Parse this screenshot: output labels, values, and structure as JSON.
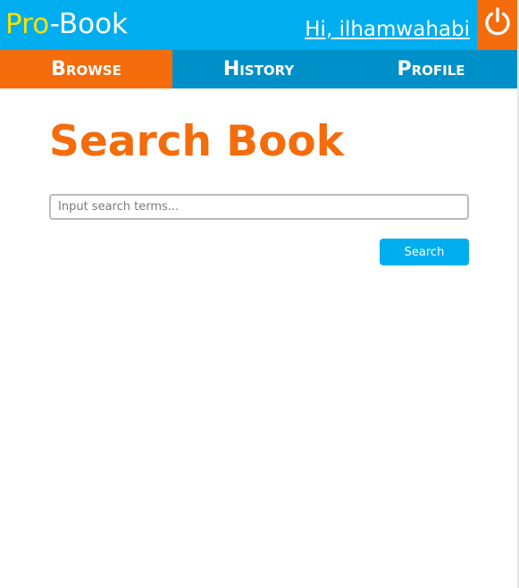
{
  "header": {
    "logo_prefix": "Pro",
    "logo_suffix": "-Book",
    "greeting": "Hi, ilhamwahabi",
    "logout_icon": "power-icon"
  },
  "nav": {
    "items": [
      {
        "label": "Browse",
        "active": true
      },
      {
        "label": "History",
        "active": false
      },
      {
        "label": "Profile",
        "active": false
      }
    ]
  },
  "main": {
    "title": "Search Book",
    "search": {
      "placeholder": "Input search terms...",
      "value": ""
    },
    "search_button_label": "Search"
  },
  "colors": {
    "primary_blue": "#00adef",
    "nav_blue": "#0090c9",
    "accent_orange": "#f46c0b",
    "logo_yellow": "#f9e000"
  }
}
